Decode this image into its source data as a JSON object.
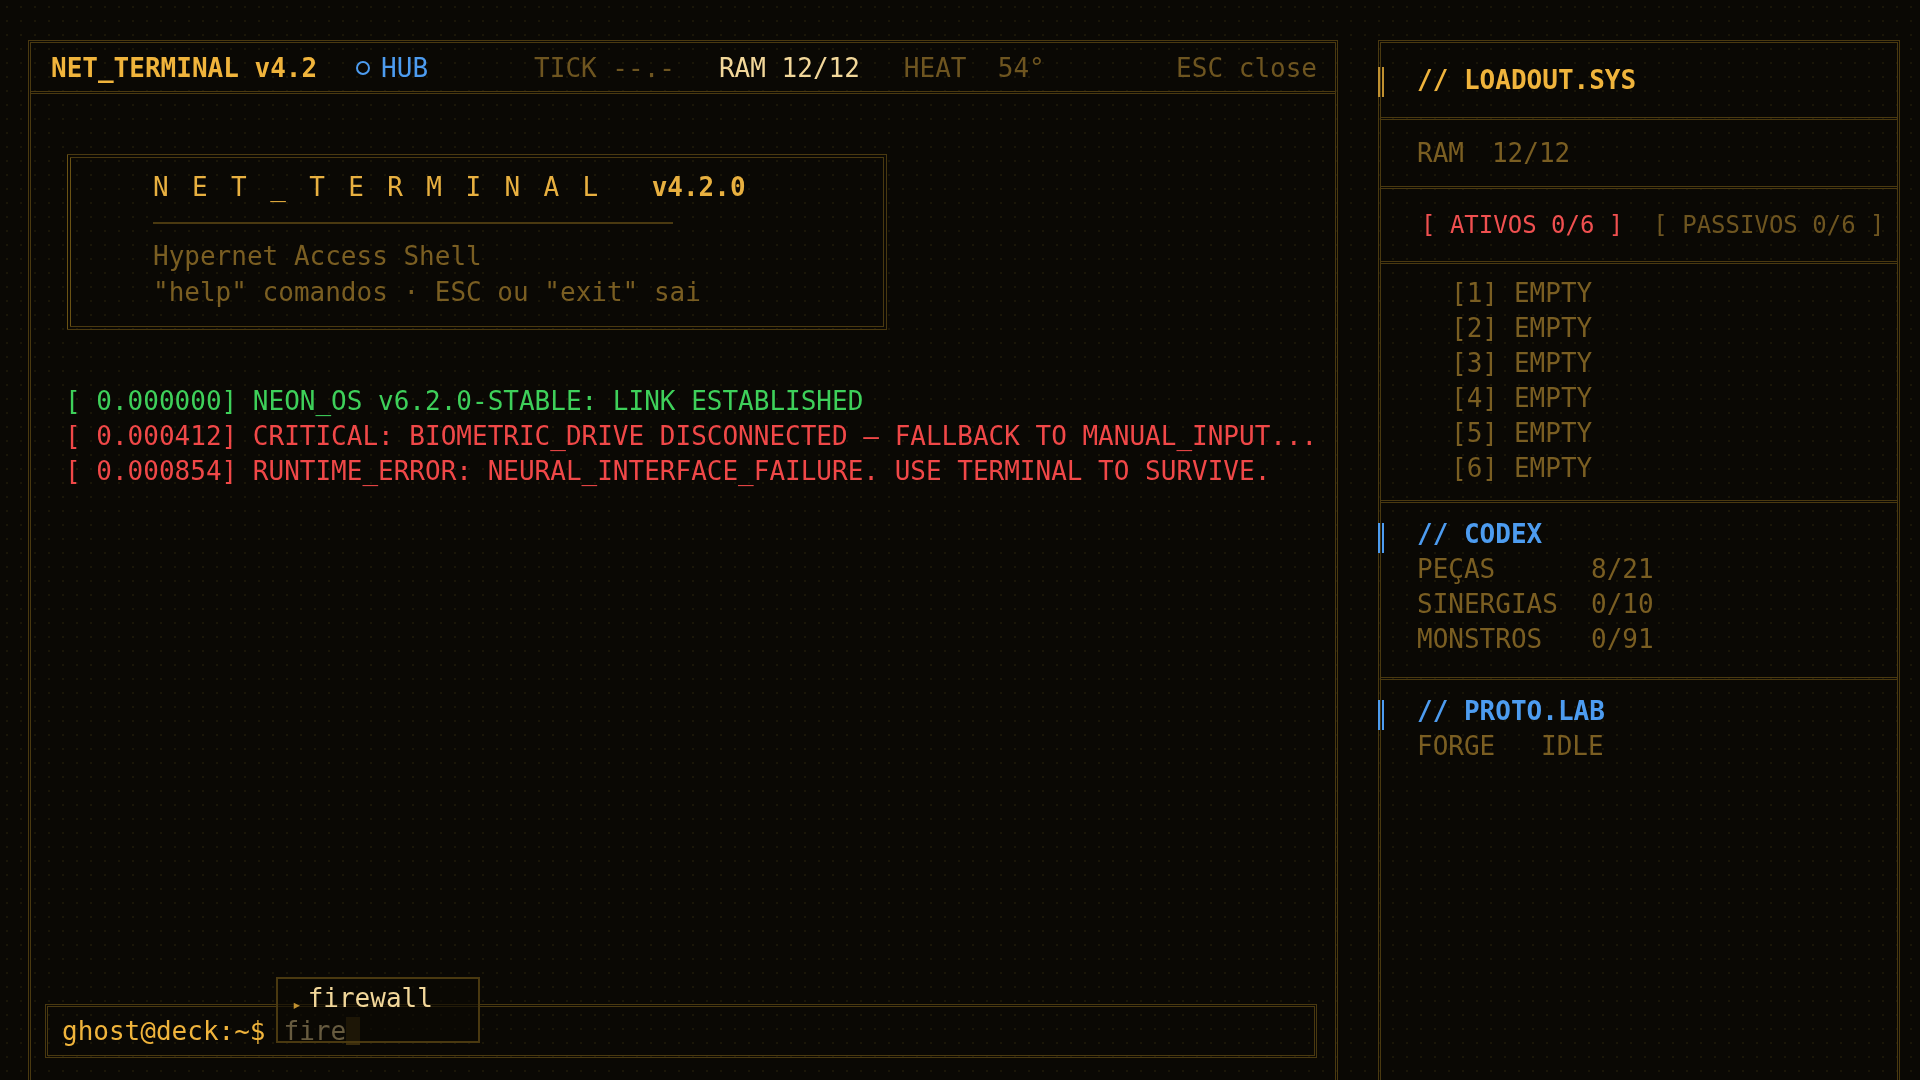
{
  "header": {
    "title": "NET_TERMINAL v4.2",
    "items": [
      {
        "kind": "link",
        "text": "HUB"
      },
      {
        "kind": "dim",
        "text": "TICK --.-"
      },
      {
        "kind": "bright",
        "text": "RAM 12/12"
      },
      {
        "kind": "dim",
        "text": "HEAT  54°"
      },
      {
        "kind": "dim",
        "text": "ESC close"
      }
    ]
  },
  "banner": {
    "title": "NET_TERMINAL",
    "version": "v4.2.0",
    "lines": [
      "Hypernet Access Shell",
      "\"help\" comandos · ESC ou \"exit\" sai"
    ]
  },
  "log": [
    {
      "color": "#3ed05a",
      "text": "[ 0.000000] NEON_OS v6.2.0-STABLE: LINK ESTABLISHED"
    },
    {
      "color": "#f04848",
      "text": "[ 0.000412] CRITICAL: BIOMETRIC_DRIVE DISCONNECTED — FALLBACK TO MANUAL_INPUT..."
    },
    {
      "color": "#f04848",
      "text": "[ 0.000854] RUNTIME_ERROR: NEURAL_INTERFACE_FAILURE. USE TERMINAL TO SURVIVE."
    }
  ],
  "prompt": {
    "label": "ghost@deck:~$",
    "value": "fire",
    "suggestions": [
      {
        "marker": "▸",
        "text": "firewall",
        "selected": true
      }
    ]
  },
  "loadout": {
    "title": "// LOADOUT.SYS",
    "ram_label": "RAM",
    "ram_value": "12/12",
    "tabs": [
      {
        "label": "[ ATIVOS 0/6 ]",
        "selected": true
      },
      {
        "label": "[ PASSIVOS 0/6 ]",
        "selected": false
      }
    ],
    "slots": [
      {
        "index": "[1]",
        "value": "EMPTY"
      },
      {
        "index": "[2]",
        "value": "EMPTY"
      },
      {
        "index": "[3]",
        "value": "EMPTY"
      },
      {
        "index": "[4]",
        "value": "EMPTY"
      },
      {
        "index": "[5]",
        "value": "EMPTY"
      },
      {
        "index": "[6]",
        "value": "EMPTY"
      }
    ]
  },
  "codex": {
    "title": "// CODEX",
    "rows": [
      {
        "label": "PEÇAS",
        "value": "8/21"
      },
      {
        "label": "SINERGIAS",
        "value": "0/10"
      },
      {
        "label": "MONSTROS",
        "value": "0/91"
      }
    ]
  },
  "proto_lab": {
    "title": "// PROTO.LAB",
    "label": "FORGE",
    "value": "IDLE"
  }
}
